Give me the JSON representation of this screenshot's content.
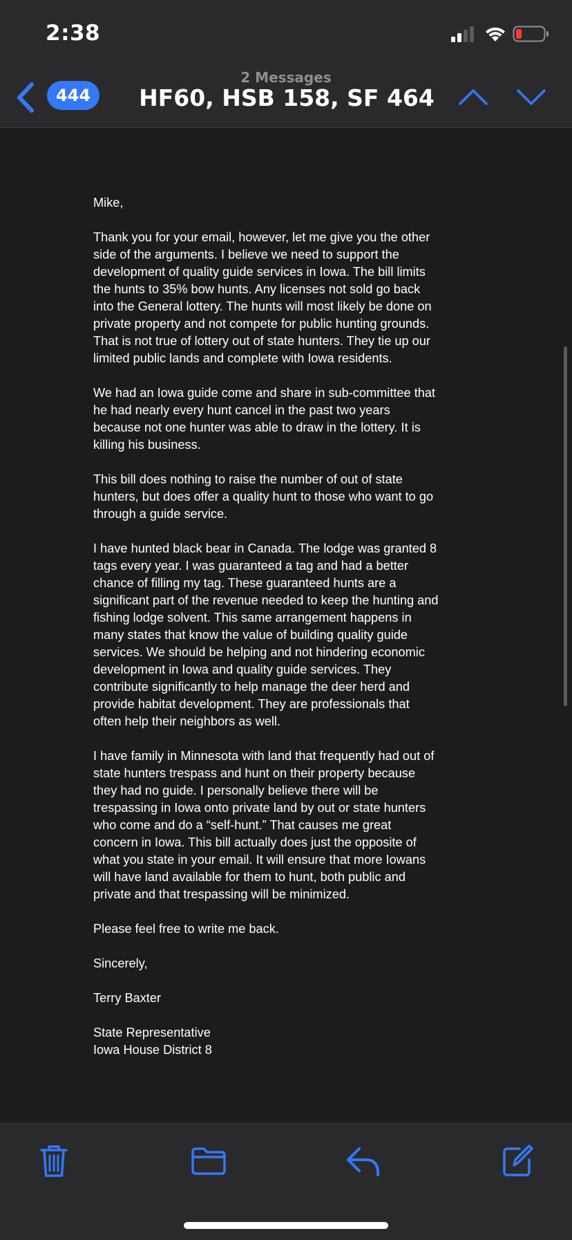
{
  "status_bar": {
    "time": "2:38"
  },
  "nav": {
    "unread_count": "444",
    "message_count": "2 Messages",
    "subject": "HF60, HSB 158, SF 464"
  },
  "message": {
    "greeting": "Mike,",
    "paragraphs": [
      "Thank you for your email, however, let me give you the other side of the arguments.  I believe we need to support the development of quality guide services in Iowa.  The bill limits the hunts to 35% bow hunts.  Any licenses not sold go back into the General lottery.  The hunts will most likely be done on private property and not compete for public hunting grounds. That is not true of lottery out of state hunters.  They tie up our limited public lands and complete with Iowa residents.",
      "We had an Iowa guide come and share in sub-committee that he had nearly every hunt cancel in the past two years because not one hunter was able to draw in the lottery.  It is killing his business.",
      "This bill does nothing to raise the number of out of state hunters, but does offer a quality hunt to those who want to go through a guide service.",
      "I have hunted black bear in Canada.  The lodge was granted 8 tags every year.  I was guaranteed a tag and had a better chance of filling my tag.  These guaranteed hunts are a significant part of the revenue needed to keep the hunting and fishing lodge solvent.  This same arrangement happens in many states that know the value of building quality guide services.  We should be helping and not hindering economic development in Iowa and quality guide services.  They contribute significantly to help manage the deer herd and provide habitat development.  They are professionals that often help their neighbors as well.",
      "I have family in Minnesota with land that frequently had out of state hunters trespass and hunt on their property because they had no guide.  I personally believe there will be trespassing in Iowa onto private land by out or state hunters who come and do a “self-hunt.”  That causes me great concern in Iowa.    This bill actually does just the opposite of what you state in your email.  It will ensure that more Iowans will have land available for them to hunt, both public and private and that trespassing will be minimized.",
      "Please feel free to write me back."
    ],
    "closing": "Sincerely,",
    "signature_name": "Terry Baxter",
    "signature_title": "State Representative",
    "signature_district": "Iowa House District 8"
  },
  "colors": {
    "accent": "#3478f6",
    "background": "#1c1c1e",
    "bar": "#2a2a2c"
  },
  "icons": {
    "back": "chevron-left-icon",
    "up": "chevron-up-icon",
    "down": "chevron-down-icon",
    "trash": "trash-icon",
    "folder": "folder-icon",
    "reply": "reply-icon",
    "compose": "compose-icon"
  }
}
